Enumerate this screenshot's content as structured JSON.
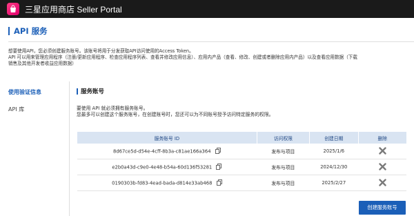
{
  "header": {
    "brand": "三星应用商店 Seller Portal",
    "logo_icon": "galaxy-store-bag-icon",
    "bg_color": "#1a1a1a",
    "accent": "#e0006e"
  },
  "page": {
    "title": "API 服务",
    "intro_line1": "想要使用API，您必须创建服务账号。该账号将用于分发获取API访问使用的Access Token。",
    "intro_line2": "API 可以用来管理应用程序（注册/更新应用程序、检查应用程序列表、查看并修改应用信息）、应用内产品（查看、修改、创建或者删除应用内产品）以及查看应用数据（下载",
    "intro_line3": "销售及其他开发者收益应用数据）"
  },
  "sidebar": {
    "items": [
      {
        "label": "使用验证信息",
        "active": true
      },
      {
        "label": "API 库",
        "active": false
      }
    ]
  },
  "section": {
    "title": "服务账号",
    "desc_line1": "要使用 API 就必须拥有服务账号。",
    "desc_line2": "您最多可以创建这个服务账号，在创建账号时，您还可以为不同账号授予访问特定服务的权限。"
  },
  "table": {
    "headers": [
      "服务账号 ID",
      "访问权限",
      "创建日期",
      "删除"
    ],
    "rows": [
      {
        "id": "8d67ce5d-d54e-4cff-8b3a-c81ae166a364",
        "permission": "发布与项目",
        "date": "2025/1/6"
      },
      {
        "id": "e2b0a43d-c9e0-4e48-b54a-60d136f53281",
        "permission": "发布与项目",
        "date": "2024/12/30"
      },
      {
        "id": "0190303b-fd83-4ead-bada-d814e33ab468",
        "permission": "发布与项目",
        "date": "2025/2/27"
      }
    ],
    "copy_icon": "copy-icon",
    "delete_icon": "delete-x-icon"
  },
  "actions": {
    "create_label": "创建服务账号"
  },
  "colors": {
    "primary": "#1b5fb8",
    "table_header_bg": "#d9e4f2"
  }
}
